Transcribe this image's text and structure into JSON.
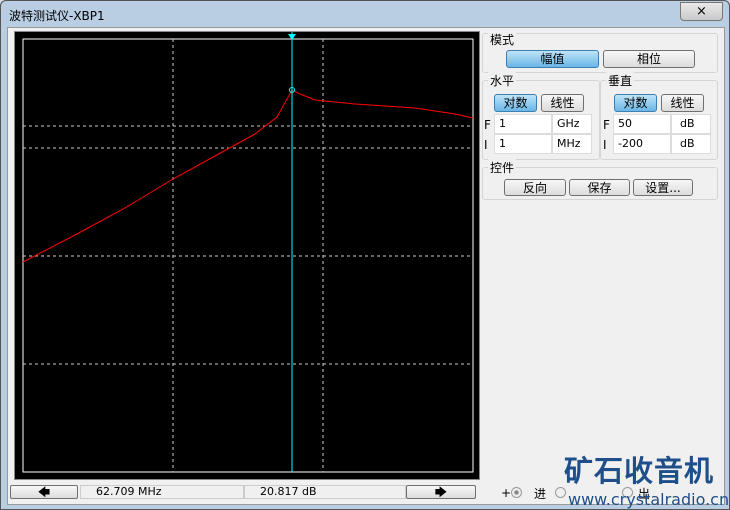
{
  "window": {
    "title": "波特测试仪-XBP1",
    "close_icon": "×"
  },
  "mode": {
    "label": "模式",
    "magnitude": "幅值",
    "phase": "相位"
  },
  "horizontal": {
    "label": "水平",
    "log": "对数",
    "linear": "线性",
    "f_label": "F",
    "f_value": "1",
    "f_unit": "GHz",
    "i_label": "I",
    "i_value": "1",
    "i_unit": "MHz"
  },
  "vertical": {
    "label": "垂直",
    "log": "对数",
    "linear": "线性",
    "f_label": "F",
    "f_value": "50",
    "f_unit": "dB",
    "i_label": "I",
    "i_value": "-200",
    "i_unit": "dB"
  },
  "controls": {
    "label": "控件",
    "reverse": "反向",
    "save": "保存",
    "settings": "设置..."
  },
  "status": {
    "left_arrow": "🡄",
    "frequency": "62.709 MHz",
    "gain": "20.817 dB",
    "right_arrow": "🡆"
  },
  "terminals": {
    "plus": "+",
    "in": "进",
    "minus": "-",
    "out": "出"
  },
  "watermark": {
    "title": "矿石收音机",
    "url": "www.crystalradio.cn"
  },
  "colors": {
    "trace": "#ff0000",
    "cursor": "#00ffff"
  }
}
